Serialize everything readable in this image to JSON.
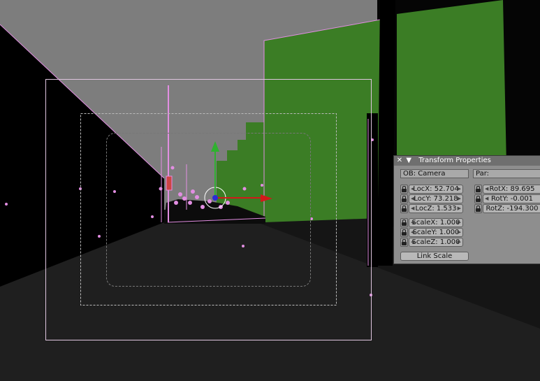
{
  "colors": {
    "sky": "#7d7d7d",
    "ground": "#151515",
    "building_green": "#3b7d25",
    "selection_outline": "#e28ee2",
    "axis_x": "#d11a1a",
    "axis_y": "#2fb12f",
    "axis_z": "#2a2ad6",
    "panel_bg": "#8e8e8e",
    "panel_header": "#6f6f6f"
  },
  "transform_panel": {
    "close_icon": "close-icon",
    "collapse_icon": "triangle-down-icon",
    "title": "Transform Properties",
    "object_field": "OB: Camera",
    "parent_field": "Par:",
    "loc_x": "LocX: 52.704",
    "loc_y": "LocY: 73.218",
    "loc_z": "LocZ: 1.533",
    "rot_x": "RotX: 89.695",
    "rot_y": "RotY: -0.001",
    "rot_z": "RotZ: -194.300",
    "scale_x": "ScaleX: 1.000",
    "scale_y": "ScaleY: 1.000",
    "scale_z": "ScaleZ: 1.000",
    "link_scale": "Link Scale"
  }
}
